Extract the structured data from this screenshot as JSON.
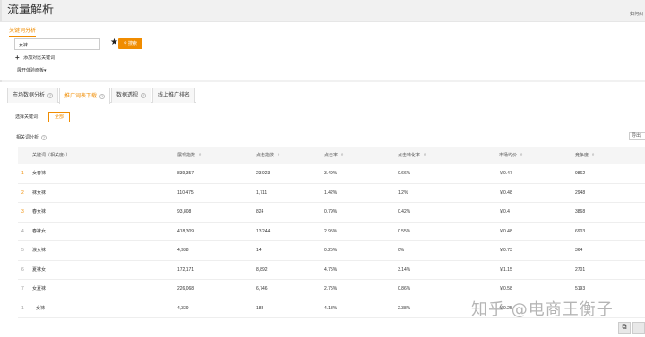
{
  "page": {
    "title": "流量解析",
    "top_right": "如何纠"
  },
  "search": {
    "tab_label": "关键词分析",
    "input_value": "女袜",
    "button_label": "搜索",
    "add_compare": "添加对比关键词",
    "expand_board": "展开体验面板▾"
  },
  "tabs": [
    {
      "label": "市场数据分析"
    },
    {
      "label": "推广词表下载"
    },
    {
      "label": "数据透视"
    },
    {
      "label": "线上推广排名"
    }
  ],
  "filter": {
    "choose_label": "选择关键词：",
    "all_label": "全部"
  },
  "related": {
    "title": "相关词分析",
    "export_label": "导出"
  },
  "table": {
    "headers": [
      "关键词（相关度↓）",
      "展现指数",
      "点击指数",
      "点击率",
      "点击转化率",
      "市场均价",
      "竞争度"
    ],
    "rows": [
      {
        "rank": "1",
        "keyword": "女春袜",
        "impressions": "839,357",
        "clicks": "23,923",
        "ctr": "3.49%",
        "cvr": "0.66%",
        "price": "￥0.47",
        "competition": "9862"
      },
      {
        "rank": "2",
        "keyword": "袜女袜",
        "impressions": "110,475",
        "clicks": "1,711",
        "ctr": "1.42%",
        "cvr": "1.2%",
        "price": "￥0.48",
        "competition": "2948"
      },
      {
        "rank": "3",
        "keyword": "春女袜",
        "impressions": "93,808",
        "clicks": "824",
        "ctr": "0.79%",
        "cvr": "0.42%",
        "price": "￥0.4",
        "competition": "3868"
      },
      {
        "rank": "4",
        "keyword": "春袜女",
        "impressions": "418,309",
        "clicks": "13,244",
        "ctr": "2.95%",
        "cvr": "0.55%",
        "price": "￥0.48",
        "competition": "6903"
      },
      {
        "rank": "5",
        "keyword": "浪女袜",
        "impressions": "4,938",
        "clicks": "14",
        "ctr": "0.25%",
        "cvr": "0%",
        "price": "￥0.73",
        "competition": "364"
      },
      {
        "rank": "6",
        "keyword": "夏袜女",
        "impressions": "172,171",
        "clicks": "8,892",
        "ctr": "4.75%",
        "cvr": "3.14%",
        "price": "￥1.15",
        "competition": "2701"
      },
      {
        "rank": "7",
        "keyword": "女夏袜",
        "impressions": "226,068",
        "clicks": "6,746",
        "ctr": "2.75%",
        "cvr": "0.86%",
        "price": "￥0.58",
        "competition": "5193"
      },
      {
        "rank": "1",
        "keyword": "女袜",
        "impressions": "4,339",
        "clicks": "188",
        "ctr": "4.18%",
        "cvr": "2.38%",
        "price": "￥0.25",
        "competition": ""
      }
    ]
  },
  "watermark": "知乎 @电商王衡子",
  "colors": {
    "accent": "#f08c00"
  }
}
